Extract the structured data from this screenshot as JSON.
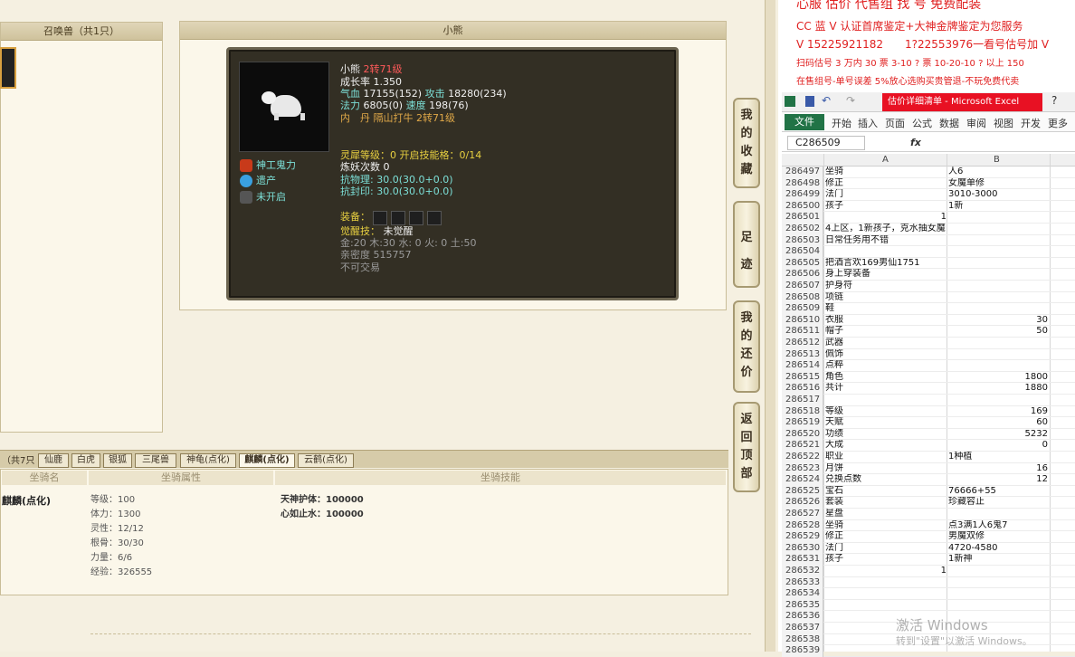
{
  "game": {
    "summon_title": "召唤兽（共1只）",
    "pet_title": "小熊",
    "pet": {
      "name": "小熊",
      "rebirth": "2转71级",
      "growth": "成长率 1.350",
      "hp_label": "气血",
      "hp": "17155(152)",
      "atk_label": "攻击",
      "atk": "18280(234)",
      "mp_label": "法力",
      "mp": "6805(0)",
      "spd_label": "速度",
      "spd": "198(76)",
      "neidan": "内　丹 隔山打牛 2转71级",
      "side": [
        "神工鬼力",
        "遗产",
        "未开启"
      ],
      "spirit": "灵犀等级：0 开启技能格：0/14",
      "refine": "炼妖次数 0",
      "resist_phys": "抗物理: 30.0(30.0+0.0)",
      "resist_seal": "抗封印: 30.0(30.0+0.0)",
      "equip_label": "装备：",
      "awaken_label": "觉醒技：",
      "awaken_value": "未觉醒",
      "elements": "金:20 木:30 水: 0 火: 0 土:50",
      "intimacy": "亲密度 515757",
      "trade": "不可交易"
    },
    "mount_count": "（共7只",
    "mount_tabs": [
      "仙鹿",
      "白虎",
      "银狐",
      "三尾兽",
      "神龟(点化)",
      "麒麟(点化)",
      "云鹤(点化)"
    ],
    "mount_heads": [
      "坐骑名",
      "坐骑属性",
      "坐骑技能"
    ],
    "mount_name": "麒麟(点化)",
    "mount_attrs": [
      "等级：100",
      "体力：1300",
      "灵性：12/12",
      "根骨：30/30",
      "力量：6/6",
      "经验：326555"
    ],
    "mount_skills": [
      "天神护体：100000",
      "心如止水：100000"
    ],
    "vbtns": [
      [
        "我",
        "的",
        "收",
        "藏"
      ],
      [
        "足",
        "迹"
      ],
      [
        "我",
        "的",
        "还",
        "价"
      ],
      [
        "返",
        "回",
        "顶",
        "部"
      ]
    ]
  },
  "overlay": {
    "top_red": "心服 估价 代售组 找 号 免费配装",
    "line1": "CC 蓝 V 认证首席鉴定+大神金牌鉴定为您服务",
    "line2": "V 15225921182　　1?22553976一看号估号加 V",
    "line3": "扫码估号 3 万内 30 票 3-10 ? 票 10-20-10 ? 以上 150",
    "line4": "在售组号-单号误差 5%放心选购买贵管退-不玩免费代卖",
    "excel_title": "估价详细清单 - Microsoft Excel",
    "excel_file": "文件",
    "ribbon_tabs": [
      "开始",
      "插入",
      "页面",
      "公式",
      "数据",
      "审阅",
      "视图",
      "开发",
      "更多"
    ],
    "namebox": "C286509",
    "fx": "fx",
    "col_a": "A",
    "col_b": "B",
    "rows": [
      [
        "286497",
        "坐骑",
        "人6"
      ],
      [
        "286498",
        "修正",
        "女魔单修"
      ],
      [
        "286499",
        "法门",
        "3010-3000"
      ],
      [
        "286500",
        "孩子",
        "1新"
      ],
      [
        "286501",
        "",
        "",
        "1"
      ],
      [
        "286502",
        "4上区，1新孩子，克水抽女魔，装备宝宝齐全",
        ""
      ],
      [
        "286503",
        "日常任务用不错",
        ""
      ],
      [
        "286504",
        "",
        ""
      ],
      [
        "286505",
        "把酒言欢169男仙1751",
        ""
      ],
      [
        "286506",
        "身上穿装备",
        ""
      ],
      [
        "286507",
        "护身符",
        ""
      ],
      [
        "286508",
        "项链",
        ""
      ],
      [
        "286509",
        "鞋",
        ""
      ],
      [
        "286510",
        "衣服",
        "30"
      ],
      [
        "286511",
        "帽子",
        "50"
      ],
      [
        "286512",
        "武器",
        ""
      ],
      [
        "286513",
        "佩饰",
        ""
      ],
      [
        "286514",
        "点粹",
        ""
      ],
      [
        "286515",
        "角色",
        "1800"
      ],
      [
        "286516",
        "共计",
        "1880"
      ],
      [
        "286517",
        "",
        ""
      ],
      [
        "286518",
        "等级",
        "169"
      ],
      [
        "286519",
        "天赋",
        "60"
      ],
      [
        "286520",
        "功绩",
        "5232"
      ],
      [
        "286521",
        "大成",
        "0"
      ],
      [
        "286522",
        "职业",
        "1种植"
      ],
      [
        "286523",
        "月饼",
        "16"
      ],
      [
        "286524",
        "兑换点数",
        "12"
      ],
      [
        "286525",
        "宝石",
        "76666+55"
      ],
      [
        "286526",
        "套装",
        "珍藏容止"
      ],
      [
        "286527",
        "星盘",
        ""
      ],
      [
        "286528",
        "坐骑",
        "点3满1人6鬼7"
      ],
      [
        "286529",
        "修正",
        "男魔双修"
      ],
      [
        "286530",
        "法门",
        "4720-4580"
      ],
      [
        "286531",
        "孩子",
        "1新神"
      ],
      [
        "286532",
        "",
        "",
        "1"
      ],
      [
        "286533",
        "",
        ""
      ],
      [
        "286534",
        "",
        ""
      ],
      [
        "286535",
        "",
        ""
      ],
      [
        "286536",
        "",
        ""
      ],
      [
        "286537",
        "",
        ""
      ],
      [
        "286538",
        "",
        ""
      ],
      [
        "286539",
        "",
        ""
      ]
    ],
    "watermark1": "激活 Windows",
    "watermark2": "转到\"设置\"以激活 Windows。"
  }
}
